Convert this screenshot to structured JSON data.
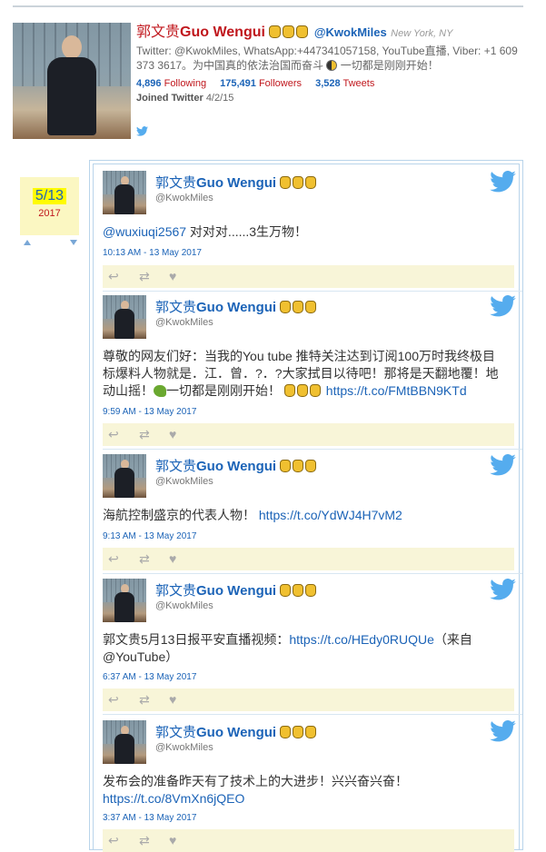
{
  "profile": {
    "name_cn": "郭文贵",
    "name_en": "Guo Wengui",
    "handle": "@KwokMiles",
    "location": "New York, NY",
    "bio_1": "Twitter: @KwokMiles, WhatsApp:+447341057158, YouTube直播, Viber: +1 609 373 3617。为中国真的依法治国而奋斗",
    "bio_2": "一切都是刚刚开始！",
    "following_count": "4,896",
    "following_label": "Following",
    "followers_count": "175,491",
    "followers_label": "Followers",
    "tweets_count": "3,528",
    "tweets_label": "Tweets",
    "joined_label": "Joined Twitter",
    "joined_date": "4/2/15"
  },
  "date_marker": {
    "month_day": "5/13",
    "year": "2017"
  },
  "tweet_author": {
    "name_cn": "郭文贵",
    "name_en": "Guo Wengui",
    "handle": "@KwokMiles"
  },
  "tweets": [
    {
      "parts": [
        {
          "text": "@wuxiuqi2567",
          "link": true
        },
        {
          "text": " 对对对......3生万物！"
        }
      ],
      "time": "10:13 AM - 13 May 2017"
    },
    {
      "text_a": "尊敬的网友们好：当我的You tube 推特关注达到订阅100万时我终极目标爆料人物就是．江．曾．?．?大家拭目以待吧！那将是天翻地覆！地动山摇！",
      "text_b": "一切都是刚刚开始！",
      "link": "https://t.co/FMtBBN9KTd",
      "time": "9:59 AM - 13 May 2017"
    },
    {
      "text": "海航控制盛京的代表人物！ ",
      "link": "https://t.co/YdWJ4H7vM2",
      "time": "9:13 AM - 13 May 2017"
    },
    {
      "text_a": "郭文贵5月13日报平安直播视频：",
      "link": "https://t.co/HEdy0RUQUe",
      "text_b": "（来自 @YouTube）",
      "time": "6:37 AM - 13 May 2017"
    },
    {
      "text": "发布会的准备昨天有了技术上的大进步！兴兴奋兴奋！",
      "link": "https://t.co/8VmXn6jQEO",
      "time": "3:37 AM - 13 May 2017"
    }
  ],
  "icons": {
    "bird_color": "#55acee",
    "action_color": "#aaaaaa"
  }
}
